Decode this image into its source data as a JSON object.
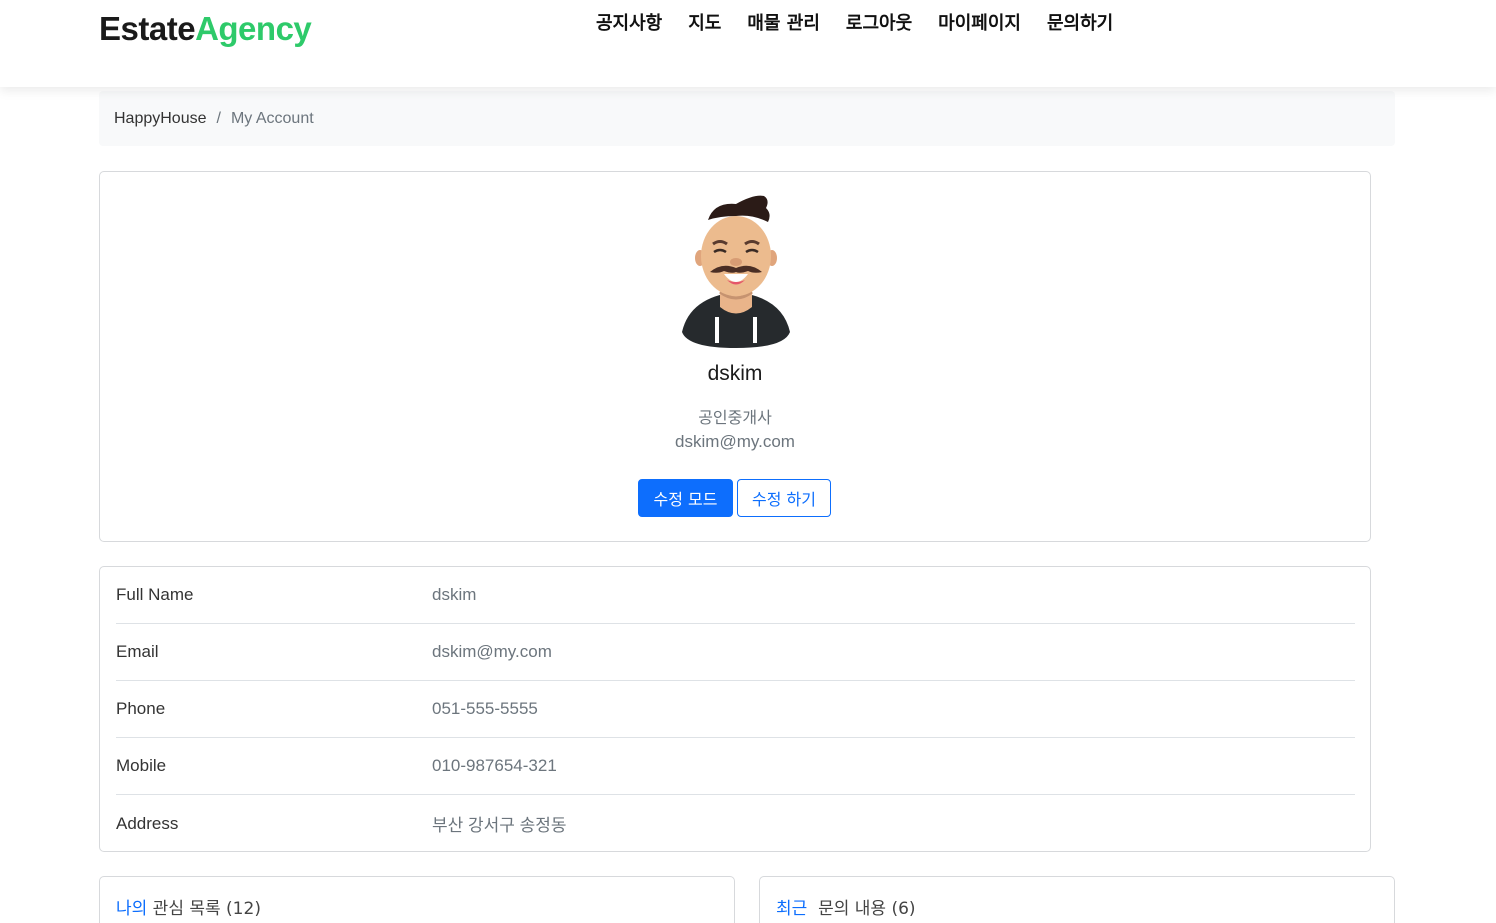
{
  "brand": {
    "part1": "Estate",
    "part2": "Agency",
    "accent_color": "#2eca6a"
  },
  "nav": {
    "items": [
      "공지사항",
      "지도",
      "매물 관리",
      "로그아웃",
      "마이페이지",
      "문의하기"
    ]
  },
  "breadcrumb": {
    "home": "HappyHouse",
    "separator": "/",
    "current": "My Account"
  },
  "profile": {
    "avatar_icon": "avatar-man-mustache",
    "name": "dskim",
    "role": "공인중개사",
    "email": "dskim@my.com",
    "edit_mode_label": "수정 모드",
    "save_label": "수정 하기",
    "primary_color": "#0d6efd"
  },
  "details": {
    "rows": [
      {
        "label": "Full Name",
        "value": "dskim"
      },
      {
        "label": "Email",
        "value": "dskim@my.com"
      },
      {
        "label": "Phone",
        "value": "051-555-5555"
      },
      {
        "label": "Mobile",
        "value": "010-987654-321"
      },
      {
        "label": "Address",
        "value": "부산 강서구 송정동"
      }
    ]
  },
  "panels": {
    "left": {
      "highlight": "나의",
      "title": " 관심 목록 (12)"
    },
    "right": {
      "highlight": "최근",
      "title": "  문의 내용 (6)"
    }
  }
}
